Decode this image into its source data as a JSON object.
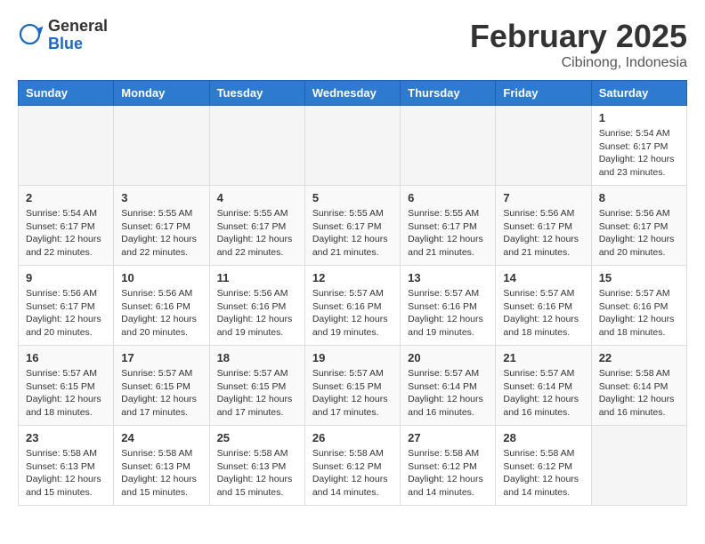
{
  "header": {
    "logo_general": "General",
    "logo_blue": "Blue",
    "month_title": "February 2025",
    "location": "Cibinong, Indonesia"
  },
  "calendar": {
    "days_of_week": [
      "Sunday",
      "Monday",
      "Tuesday",
      "Wednesday",
      "Thursday",
      "Friday",
      "Saturday"
    ],
    "weeks": [
      [
        {
          "day": "",
          "info": ""
        },
        {
          "day": "",
          "info": ""
        },
        {
          "day": "",
          "info": ""
        },
        {
          "day": "",
          "info": ""
        },
        {
          "day": "",
          "info": ""
        },
        {
          "day": "",
          "info": ""
        },
        {
          "day": "1",
          "info": "Sunrise: 5:54 AM\nSunset: 6:17 PM\nDaylight: 12 hours\nand 23 minutes."
        }
      ],
      [
        {
          "day": "2",
          "info": "Sunrise: 5:54 AM\nSunset: 6:17 PM\nDaylight: 12 hours\nand 22 minutes."
        },
        {
          "day": "3",
          "info": "Sunrise: 5:55 AM\nSunset: 6:17 PM\nDaylight: 12 hours\nand 22 minutes."
        },
        {
          "day": "4",
          "info": "Sunrise: 5:55 AM\nSunset: 6:17 PM\nDaylight: 12 hours\nand 22 minutes."
        },
        {
          "day": "5",
          "info": "Sunrise: 5:55 AM\nSunset: 6:17 PM\nDaylight: 12 hours\nand 21 minutes."
        },
        {
          "day": "6",
          "info": "Sunrise: 5:55 AM\nSunset: 6:17 PM\nDaylight: 12 hours\nand 21 minutes."
        },
        {
          "day": "7",
          "info": "Sunrise: 5:56 AM\nSunset: 6:17 PM\nDaylight: 12 hours\nand 21 minutes."
        },
        {
          "day": "8",
          "info": "Sunrise: 5:56 AM\nSunset: 6:17 PM\nDaylight: 12 hours\nand 20 minutes."
        }
      ],
      [
        {
          "day": "9",
          "info": "Sunrise: 5:56 AM\nSunset: 6:17 PM\nDaylight: 12 hours\nand 20 minutes."
        },
        {
          "day": "10",
          "info": "Sunrise: 5:56 AM\nSunset: 6:16 PM\nDaylight: 12 hours\nand 20 minutes."
        },
        {
          "day": "11",
          "info": "Sunrise: 5:56 AM\nSunset: 6:16 PM\nDaylight: 12 hours\nand 19 minutes."
        },
        {
          "day": "12",
          "info": "Sunrise: 5:57 AM\nSunset: 6:16 PM\nDaylight: 12 hours\nand 19 minutes."
        },
        {
          "day": "13",
          "info": "Sunrise: 5:57 AM\nSunset: 6:16 PM\nDaylight: 12 hours\nand 19 minutes."
        },
        {
          "day": "14",
          "info": "Sunrise: 5:57 AM\nSunset: 6:16 PM\nDaylight: 12 hours\nand 18 minutes."
        },
        {
          "day": "15",
          "info": "Sunrise: 5:57 AM\nSunset: 6:16 PM\nDaylight: 12 hours\nand 18 minutes."
        }
      ],
      [
        {
          "day": "16",
          "info": "Sunrise: 5:57 AM\nSunset: 6:15 PM\nDaylight: 12 hours\nand 18 minutes."
        },
        {
          "day": "17",
          "info": "Sunrise: 5:57 AM\nSunset: 6:15 PM\nDaylight: 12 hours\nand 17 minutes."
        },
        {
          "day": "18",
          "info": "Sunrise: 5:57 AM\nSunset: 6:15 PM\nDaylight: 12 hours\nand 17 minutes."
        },
        {
          "day": "19",
          "info": "Sunrise: 5:57 AM\nSunset: 6:15 PM\nDaylight: 12 hours\nand 17 minutes."
        },
        {
          "day": "20",
          "info": "Sunrise: 5:57 AM\nSunset: 6:14 PM\nDaylight: 12 hours\nand 16 minutes."
        },
        {
          "day": "21",
          "info": "Sunrise: 5:57 AM\nSunset: 6:14 PM\nDaylight: 12 hours\nand 16 minutes."
        },
        {
          "day": "22",
          "info": "Sunrise: 5:58 AM\nSunset: 6:14 PM\nDaylight: 12 hours\nand 16 minutes."
        }
      ],
      [
        {
          "day": "23",
          "info": "Sunrise: 5:58 AM\nSunset: 6:13 PM\nDaylight: 12 hours\nand 15 minutes."
        },
        {
          "day": "24",
          "info": "Sunrise: 5:58 AM\nSunset: 6:13 PM\nDaylight: 12 hours\nand 15 minutes."
        },
        {
          "day": "25",
          "info": "Sunrise: 5:58 AM\nSunset: 6:13 PM\nDaylight: 12 hours\nand 15 minutes."
        },
        {
          "day": "26",
          "info": "Sunrise: 5:58 AM\nSunset: 6:12 PM\nDaylight: 12 hours\nand 14 minutes."
        },
        {
          "day": "27",
          "info": "Sunrise: 5:58 AM\nSunset: 6:12 PM\nDaylight: 12 hours\nand 14 minutes."
        },
        {
          "day": "28",
          "info": "Sunrise: 5:58 AM\nSunset: 6:12 PM\nDaylight: 12 hours\nand 14 minutes."
        },
        {
          "day": "",
          "info": ""
        }
      ]
    ]
  }
}
